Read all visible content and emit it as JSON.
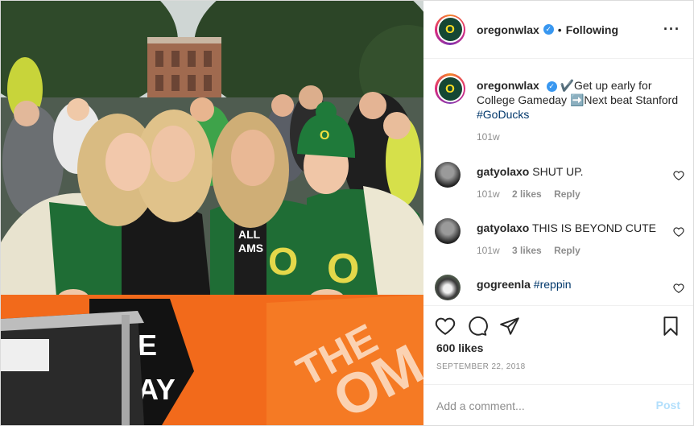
{
  "post": {
    "username": "oregonwlax",
    "follow_dot": "•",
    "follow_status": "Following",
    "more_icon": "more-horizontal-icon",
    "caption": {
      "username": "oregonwlax",
      "text_part1": "✔️Get up early for College Gameday ",
      "arrow_emoji": "➡️",
      "text_part2": "Next beat Stanford ",
      "hashtag": "#GoDucks",
      "age": "101w"
    },
    "comments": [
      {
        "username": "gatyolaxo",
        "text": "SHUT UP.",
        "age": "101w",
        "likes": "2 likes",
        "reply": "Reply"
      },
      {
        "username": "gatyolaxo",
        "text": "THIS IS BEYOND CUTE",
        "age": "101w",
        "likes": "3 likes",
        "reply": "Reply"
      },
      {
        "username": "gogreenla",
        "text": "#reppin"
      }
    ],
    "likes": "600 likes",
    "date": "SEPTEMBER 22, 2018",
    "comment_placeholder": "Add a comment...",
    "post_button": "Post",
    "photo_text": {
      "hat_letter": "O",
      "jacket_letters": "O O",
      "shirt_text": "ALL AMS",
      "banner_word": "THE",
      "banner_word2": "OM",
      "sign_fragment_1": "E",
      "sign_fragment_2": "AY"
    }
  },
  "colors": {
    "brand_green": "#154733",
    "brand_yellow": "#fee123",
    "link": "#00376b",
    "verified": "#3897f0",
    "post_disabled": "#b2dffc",
    "banner_orange": "#f26a1b"
  }
}
